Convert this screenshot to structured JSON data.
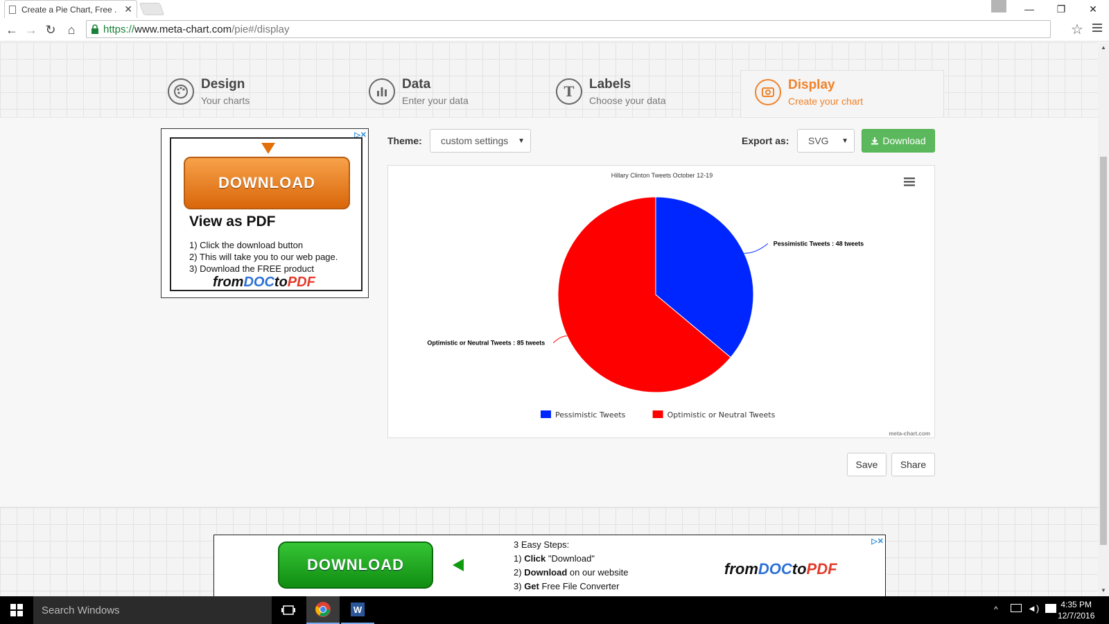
{
  "browser": {
    "tab_title": "Create a Pie Chart, Free .",
    "url_scheme": "https://",
    "url_host": "www.meta-chart.com",
    "url_path": "/pie#/display"
  },
  "steps": [
    {
      "title": "Design",
      "subtitle": "Your charts"
    },
    {
      "title": "Data",
      "subtitle": "Enter your data"
    },
    {
      "title": "Labels",
      "subtitle": "Choose your data"
    },
    {
      "title": "Display",
      "subtitle": "Create your chart"
    }
  ],
  "controls": {
    "theme_label": "Theme:",
    "theme_value": "custom settings",
    "export_label": "Export as:",
    "export_value": "SVG",
    "download_label": "Download",
    "save_label": "Save",
    "share_label": "Share"
  },
  "colors": {
    "active_step": "#f0822a",
    "download_green": "#5cb85c",
    "series_pessimistic": "#0026ff",
    "series_optimistic": "#ff0000"
  },
  "chart_data": {
    "type": "pie",
    "title": "Hillary Clinton Tweets October 12-19",
    "categories": [
      "Pessimistic Tweets",
      "Optimistic or Neutral Tweets"
    ],
    "values": [
      48,
      85
    ],
    "data_labels": [
      "Pessimistic Tweets : 48 tweets",
      "Optimistic or Neutral Tweets : 85 tweets"
    ],
    "legend": "bottom",
    "credit": "meta-chart.com"
  },
  "side_ad": {
    "choice": "▷✕",
    "button": "DOWNLOAD",
    "title": "View as PDF",
    "lines": [
      "1) Click the download button",
      "2) This will take you to our web page.",
      "3) Download the FREE product"
    ],
    "brand_from": "from",
    "brand_doc": "DOC",
    "brand_to": "to",
    "brand_pdf": "PDF"
  },
  "bottom_ad": {
    "choice": "▷✕",
    "button": "DOWNLOAD",
    "heading": "3 Easy Steps:",
    "step1_num": "1)",
    "step1_bold": "Click",
    "step1_rest": "\"Download\"",
    "step2_num": "2)",
    "step2_bold": "Download",
    "step2_rest": "on our website",
    "step3_num": "3)",
    "step3_bold": "Get",
    "step3_rest": "Free File Converter",
    "brand_from": "from",
    "brand_doc": "DOC",
    "brand_to": "to",
    "brand_pdf": "PDF"
  },
  "taskbar": {
    "search_placeholder": "Search Windows",
    "time": "4:35 PM",
    "date": "12/7/2016"
  }
}
